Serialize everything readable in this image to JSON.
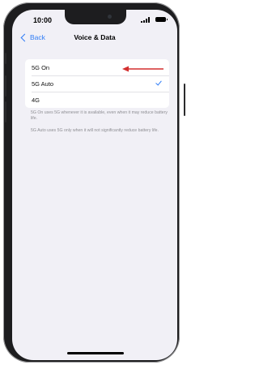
{
  "status_bar": {
    "time": "10:00"
  },
  "nav": {
    "back_label": "Back",
    "title": "Voice & Data"
  },
  "options": [
    {
      "label": "5G On",
      "selected": false,
      "highlighted": true
    },
    {
      "label": "5G Auto",
      "selected": true
    },
    {
      "label": "4G",
      "selected": false
    }
  ],
  "footnotes": {
    "five_g_on": "5G On uses 5G whenever it is available, even when it may reduce battery life.",
    "five_g_auto": "5G Auto uses 5G only when it will not significantly reduce battery life."
  },
  "colors": {
    "accent": "#2f7cf6",
    "annotation_arrow": "#d32f2f",
    "background": "#f1f0f6"
  }
}
